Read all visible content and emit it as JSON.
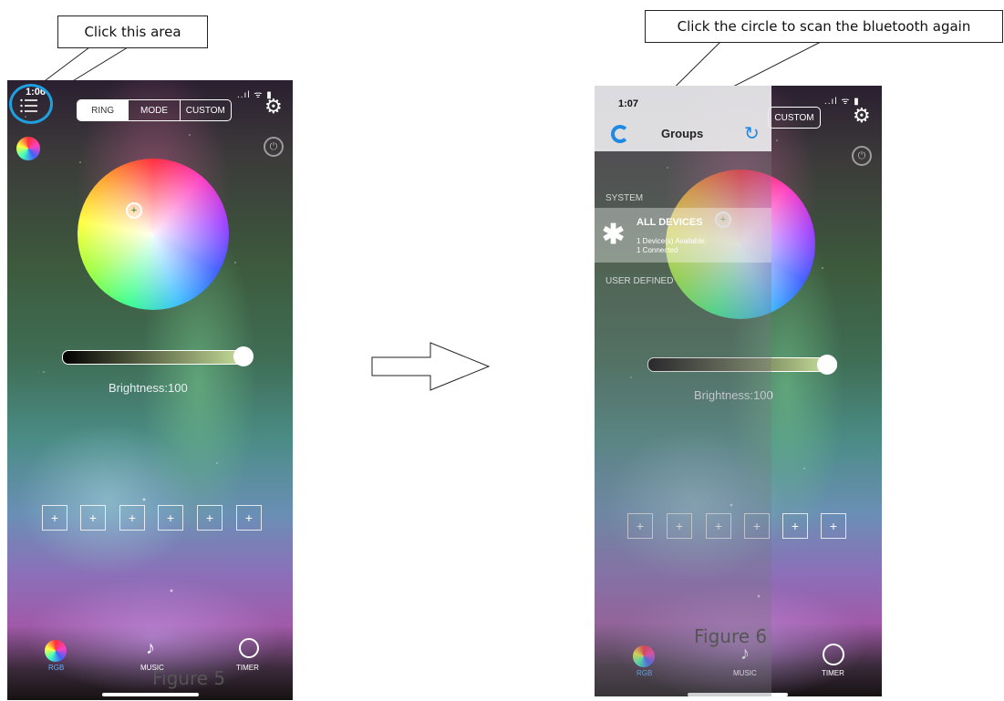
{
  "callouts": {
    "left": "Click this area",
    "right": "Click the circle to scan the bluetooth again"
  },
  "left_phone": {
    "status_time": "1:06",
    "status_icons": "..ıl ᯤ ▮",
    "menu_icon": "hamburger-menu-icon",
    "tabs": [
      "RING",
      "MODE",
      "CUSTOM"
    ],
    "active_tab": "RING",
    "brightness_label": "Brightness:100",
    "brightness_value": 1.0,
    "preset_label": "+",
    "bottom_tabs": {
      "rgb": "RGB",
      "music": "MUSIC",
      "timer": "TIMER"
    },
    "figure_caption": "Figure 5"
  },
  "right_phone": {
    "status_time": "1:07",
    "status_icons": "..ıl ᯤ ▮",
    "drawer": {
      "title": "Groups",
      "section_system": "SYSTEM",
      "device_name": "ALL DEVICES",
      "device_status_1": "1 Device(s) Available;",
      "device_status_2": "1 Connected",
      "section_user": "USER DEFINED"
    },
    "tab_visible": "CUSTOM",
    "brightness_label": "Brightness:100",
    "brightness_value": 1.0,
    "preset_label": "+",
    "bottom_tabs": {
      "rgb": "RGB",
      "music": "MUSIC",
      "timer": "TIMER"
    },
    "figure_caption": "Figure 6"
  },
  "colors": {
    "highlight": "#1ea0e0",
    "scan_icon": "#1e88e5"
  }
}
